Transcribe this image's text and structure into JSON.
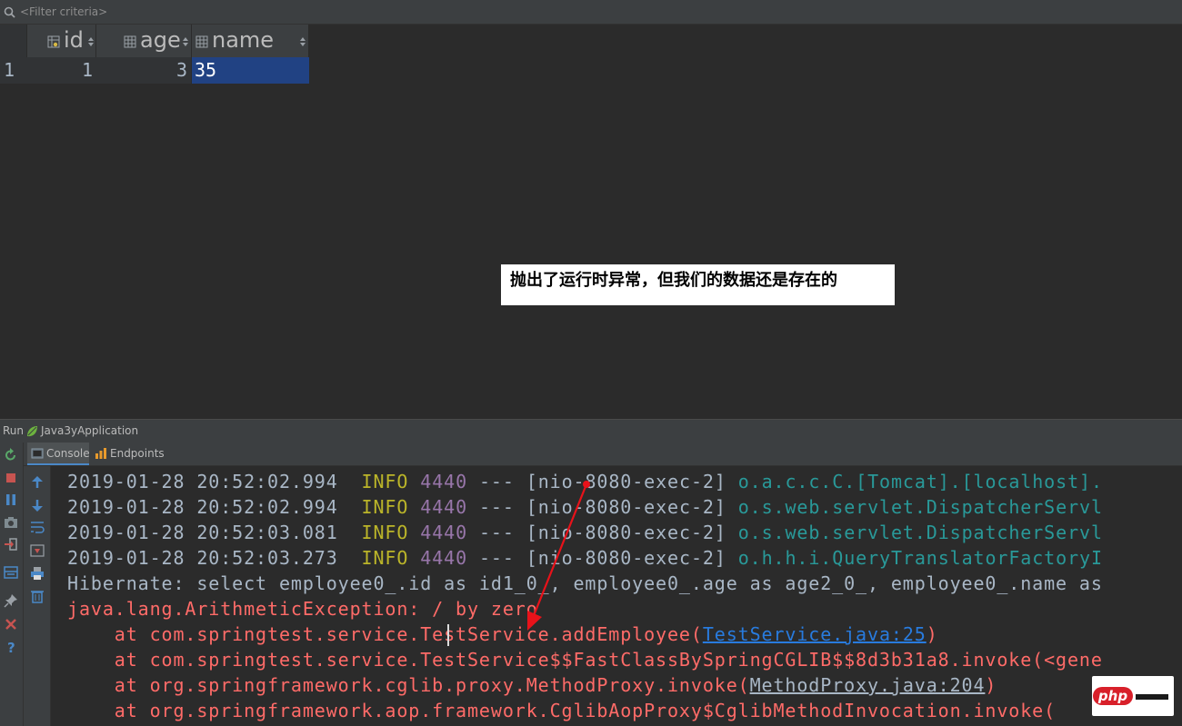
{
  "filter": {
    "placeholder": "<Filter criteria>",
    "icon": "filter-icon"
  },
  "grid": {
    "columns": [
      {
        "label": "id",
        "icon": "key-column-icon"
      },
      {
        "label": "age",
        "icon": "column-icon"
      },
      {
        "label": "name",
        "icon": "column-icon"
      }
    ],
    "rows": [
      {
        "row_number": "1",
        "id": "1",
        "age": "3",
        "name": "35"
      }
    ]
  },
  "annotation": {
    "text": "抛出了运行时异常，但我们的数据还是存在的",
    "background": "#ffffff"
  },
  "run": {
    "label": "Run",
    "config": "Java3yApplication",
    "tabs": [
      {
        "label": "Console",
        "icon": "console-icon",
        "active": true
      },
      {
        "label": "Endpoints",
        "icon": "endpoints-icon",
        "active": false
      }
    ],
    "left_toolbar": [
      "rerun-icon",
      "stop-icon",
      "pause-icon",
      "camera-icon",
      "login-icon",
      "layout-icon",
      "pin-icon",
      "close-icon",
      "help-icon"
    ],
    "console_toolbar": [
      "scroll-up-icon",
      "scroll-down-icon",
      "soft-wrap-icon",
      "scroll-to-end-icon",
      "print-icon",
      "clear-icon"
    ]
  },
  "console": {
    "log_lines": [
      {
        "timestamp": "2019-01-28 20:52:02.994",
        "level": "INFO",
        "pid": "4440",
        "sep": "---",
        "thread": "[nio-8080-exec-2]",
        "logger": "o.a.c.c.C.[Tomcat].[localhost]."
      },
      {
        "timestamp": "2019-01-28 20:52:02.994",
        "level": "INFO",
        "pid": "4440",
        "sep": "---",
        "thread": "[nio-8080-exec-2]",
        "logger": "o.s.web.servlet.DispatcherServl"
      },
      {
        "timestamp": "2019-01-28 20:52:03.081",
        "level": "INFO",
        "pid": "4440",
        "sep": "---",
        "thread": "[nio-8080-exec-2]",
        "logger": "o.s.web.servlet.DispatcherServl"
      },
      {
        "timestamp": "2019-01-28 20:52:03.273",
        "level": "INFO",
        "pid": "4440",
        "sep": "---",
        "thread": "[nio-8080-exec-2]",
        "logger": "o.h.h.i.QueryTranslatorFactoryI"
      }
    ],
    "hibernate_line": "Hibernate: select employee0_.id as id1_0_, employee0_.age as age2_0_, employee0_.name as",
    "exception_line": "java.lang.ArithmeticException: / by zero",
    "stack": [
      {
        "prefix": "    at com.springtest.service.TestService.addEmployee(",
        "link": "TestService.java:25",
        "suffix": ")",
        "link_style": "blue"
      },
      {
        "prefix": "    at com.springtest.service.TestService$$FastClassBySpringCGLIB$$8d3b31a8.invoke(<gene",
        "link": "",
        "suffix": "",
        "link_style": "none"
      },
      {
        "prefix": "    at org.springframework.cglib.proxy.MethodProxy.invoke(",
        "link": "MethodProxy.java:204",
        "suffix": ")",
        "link_style": "grey"
      },
      {
        "prefix": "    at org.springframework.aop.framework.CglibAopProxy$CglibMethodInvocation.invoke(",
        "link": "",
        "suffix": "",
        "link_style": "none"
      }
    ]
  },
  "watermark": {
    "text": "php"
  },
  "colors": {
    "selection": "#214283",
    "info": "#bbb529",
    "pid": "#9876aa",
    "logger": "#299999",
    "error": "#ff6b68",
    "link": "#287bde",
    "arrow": "#e8121a"
  }
}
